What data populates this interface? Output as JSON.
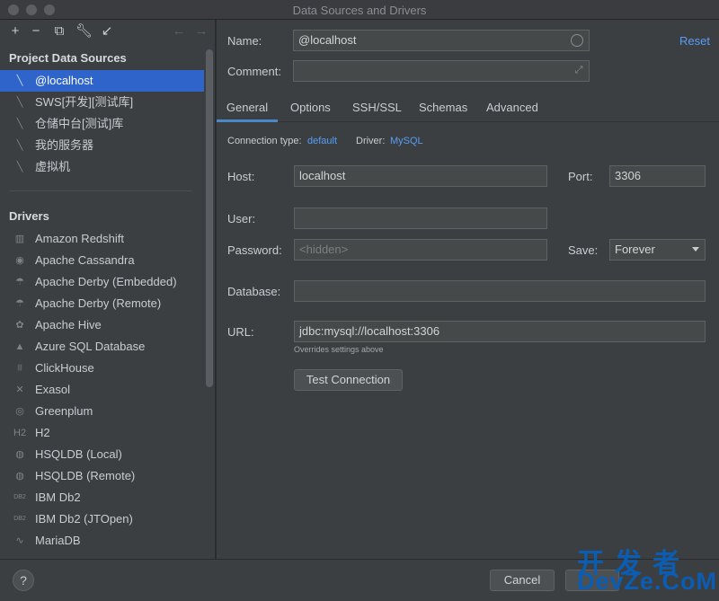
{
  "window": {
    "title": "Data Sources and Drivers"
  },
  "left_toolbar": {
    "icons": [
      "add-icon",
      "remove-icon",
      "duplicate-icon",
      "wrench-icon",
      "make-global-icon",
      "back-icon",
      "forward-icon"
    ]
  },
  "project_sources": {
    "heading": "Project Data Sources",
    "items": [
      {
        "label": "@localhost",
        "selected": true
      },
      {
        "label": "SWS[开发][测试库]"
      },
      {
        "label": "仓储中台[测试]库"
      },
      {
        "label": "我的服务器"
      },
      {
        "label": "虚拟机"
      }
    ]
  },
  "drivers": {
    "heading": "Drivers",
    "items": [
      {
        "label": "Amazon Redshift",
        "glyph": "▥"
      },
      {
        "label": "Apache Cassandra",
        "glyph": "◉"
      },
      {
        "label": "Apache Derby (Embedded)",
        "glyph": "☂"
      },
      {
        "label": "Apache Derby (Remote)",
        "glyph": "☂"
      },
      {
        "label": "Apache Hive",
        "glyph": "✿"
      },
      {
        "label": "Azure SQL Database",
        "glyph": "▲"
      },
      {
        "label": "ClickHouse",
        "glyph": "|||"
      },
      {
        "label": "Exasol",
        "glyph": "✕"
      },
      {
        "label": "Greenplum",
        "glyph": "◎"
      },
      {
        "label": "H2",
        "glyph": "H2"
      },
      {
        "label": "HSQLDB (Local)",
        "glyph": "◍"
      },
      {
        "label": "HSQLDB (Remote)",
        "glyph": "◍"
      },
      {
        "label": "IBM Db2",
        "glyph": "DB2"
      },
      {
        "label": "IBM Db2 (JTOpen)",
        "glyph": "DB2"
      },
      {
        "label": "MariaDB",
        "glyph": "∿"
      }
    ]
  },
  "form": {
    "name_label": "Name:",
    "name_value": "@localhost",
    "comment_label": "Comment:",
    "comment_value": "",
    "reset_label": "Reset"
  },
  "tabs": [
    "General",
    "Options",
    "SSH/SSL",
    "Schemas",
    "Advanced"
  ],
  "general": {
    "conn_type_label": "Connection type:",
    "conn_type_value": "default",
    "driver_label": "Driver:",
    "driver_value": "MySQL",
    "host_label": "Host:",
    "host_value": "localhost",
    "port_label": "Port:",
    "port_value": "3306",
    "user_label": "User:",
    "user_value": "",
    "password_label": "Password:",
    "password_placeholder": "<hidden>",
    "save_label": "Save:",
    "save_value": "Forever",
    "database_label": "Database:",
    "database_value": "",
    "url_label": "URL:",
    "url_value": "jdbc:mysql://localhost:3306",
    "url_hint": "Overrides settings above",
    "test_button": "Test Connection"
  },
  "bottom": {
    "help_label": "?",
    "cancel_label": "Cancel"
  },
  "watermark": {
    "cn": "开发者",
    "en": "DevZe.CoM"
  },
  "colors": {
    "accent": "#589df6",
    "selection": "#2f65ca",
    "panel": "#3c3f41"
  }
}
